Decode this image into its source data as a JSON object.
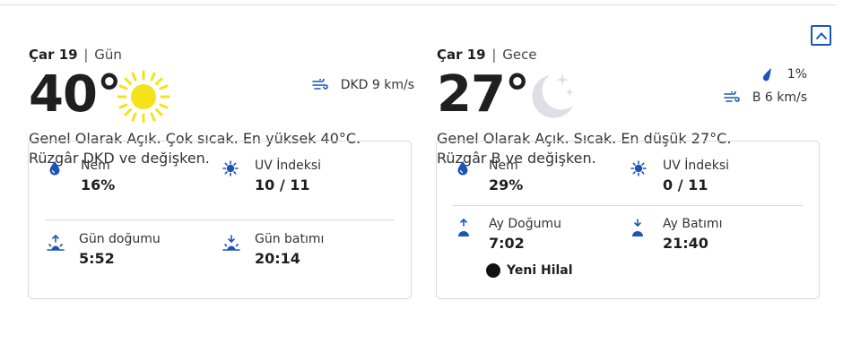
{
  "controls": {
    "collapse_icon": "chevron-up-icon"
  },
  "day": {
    "day_name": "Çar 19",
    "separator": "|",
    "period": "Gün",
    "temperature": "40°",
    "icon": "sun-icon",
    "wind": "DKD 9 km/s",
    "description_line1": "Genel Olarak Açık. Çok sıcak. En yüksek 40°C.",
    "description_line2": "Rüzgâr DKD ve değişken.",
    "details": {
      "humidity_label": "Nem",
      "humidity_value": "16%",
      "uv_label": "UV İndeksi",
      "uv_value": "10 / 11",
      "sunrise_label": "Gün doğumu",
      "sunrise_value": "5:52",
      "sunset_label": "Gün batımı",
      "sunset_value": "20:14"
    }
  },
  "night": {
    "day_name": "Çar 19",
    "separator": "|",
    "period": "Gece",
    "temperature": "27°",
    "icon": "moon-stars-icon",
    "precipitation": "1%",
    "wind": "B 6 km/s",
    "description_line1": "Genel Olarak Açık. Sıcak. En düşük 27°C.",
    "description_line2": "Rüzgâr B ve değişken.",
    "details": {
      "humidity_label": "Nem",
      "humidity_value": "29%",
      "uv_label": "UV İndeksi",
      "uv_value": "0 / 11",
      "moonrise_label": "Ay Doğumu",
      "moonrise_value": "7:02",
      "moonset_label": "Ay Batımı",
      "moonset_value": "21:40",
      "moon_phase": "Yeni Hilal"
    }
  },
  "colors": {
    "accent": "#1a55b8",
    "sun": "#f5e21a",
    "moon": "#dedee4"
  }
}
